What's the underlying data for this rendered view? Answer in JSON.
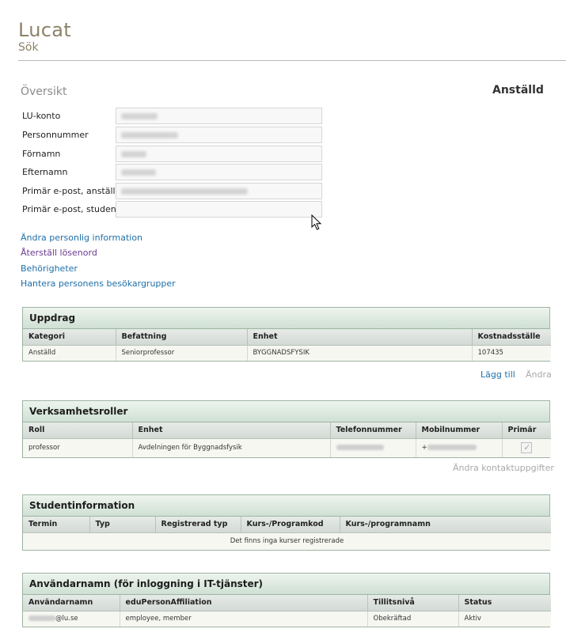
{
  "app": {
    "title": "Lucat",
    "subtitle": "Sök"
  },
  "overview": {
    "title": "Översikt",
    "role": "Anställd",
    "fields": [
      {
        "label": "LU-konto",
        "value": ""
      },
      {
        "label": "Personnummer",
        "value": ""
      },
      {
        "label": "Förnamn",
        "value": ""
      },
      {
        "label": "Efternamn",
        "value": ""
      },
      {
        "label": "Primär e-post, anställd",
        "value": ""
      },
      {
        "label": "Primär e-post, student",
        "value": ""
      }
    ]
  },
  "links": [
    "Ändra personlig information",
    "Återställ lösenord",
    "Behörigheter",
    "Hantera personens besökargrupper"
  ],
  "uppdrag": {
    "title": "Uppdrag",
    "columns": [
      "Kategori",
      "Befattning",
      "Enhet",
      "Kostnadsställe"
    ],
    "rows": [
      [
        "Anställd",
        "Seniorprofessor",
        "BYGGNADSFYSIK",
        "107435"
      ]
    ],
    "add_label": "Lägg till",
    "edit_label": "Ändra"
  },
  "verksamhetsroller": {
    "title": "Verksamhetsroller",
    "columns": [
      "Roll",
      "Enhet",
      "Telefonnummer",
      "Mobilnummer",
      "Primär"
    ],
    "rows": [
      {
        "roll": "professor",
        "enhet": "Avdelningen för Byggnadsfysik",
        "telefon": "",
        "mobil_prefix": "+",
        "primary": true
      }
    ],
    "edit_contact_label": "Ändra kontaktuppgifter"
  },
  "studentinformation": {
    "title": "Studentinformation",
    "columns": [
      "Termin",
      "Typ",
      "Registrerad typ",
      "Kurs-/Programkod",
      "Kurs-/programnamn"
    ],
    "empty_text": "Det finns inga kurser registrerade"
  },
  "anvandarnamn": {
    "title": "Användarnamn (för inloggning i IT-tjänster)",
    "columns": [
      "Användarnamn",
      "eduPersonAffiliation",
      "Tillitsnivå",
      "Status"
    ],
    "rows": [
      {
        "username_suffix": "@lu.se",
        "affiliation": "employee, member",
        "level": "Obekräftad",
        "status": "Aktiv"
      }
    ]
  }
}
